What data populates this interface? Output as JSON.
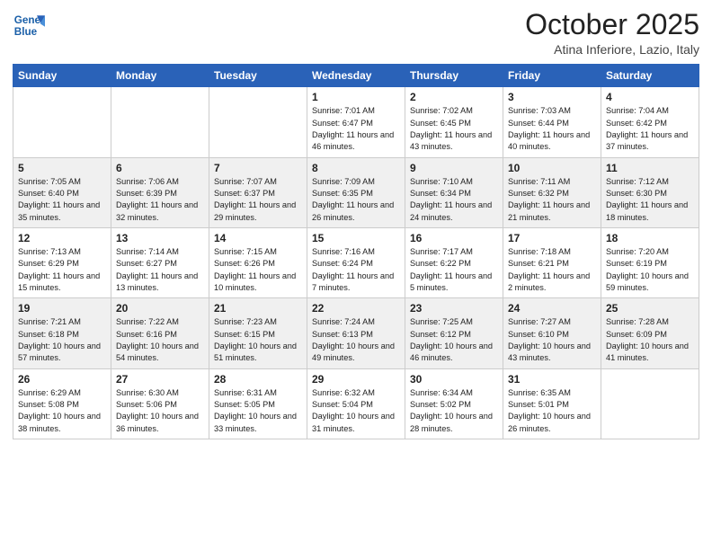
{
  "header": {
    "logo_line1": "General",
    "logo_line2": "Blue",
    "month_title": "October 2025",
    "location": "Atina Inferiore, Lazio, Italy"
  },
  "days_of_week": [
    "Sunday",
    "Monday",
    "Tuesday",
    "Wednesday",
    "Thursday",
    "Friday",
    "Saturday"
  ],
  "weeks": [
    [
      {
        "day": "",
        "info": ""
      },
      {
        "day": "",
        "info": ""
      },
      {
        "day": "",
        "info": ""
      },
      {
        "day": "1",
        "info": "Sunrise: 7:01 AM\nSunset: 6:47 PM\nDaylight: 11 hours and 46 minutes."
      },
      {
        "day": "2",
        "info": "Sunrise: 7:02 AM\nSunset: 6:45 PM\nDaylight: 11 hours and 43 minutes."
      },
      {
        "day": "3",
        "info": "Sunrise: 7:03 AM\nSunset: 6:44 PM\nDaylight: 11 hours and 40 minutes."
      },
      {
        "day": "4",
        "info": "Sunrise: 7:04 AM\nSunset: 6:42 PM\nDaylight: 11 hours and 37 minutes."
      }
    ],
    [
      {
        "day": "5",
        "info": "Sunrise: 7:05 AM\nSunset: 6:40 PM\nDaylight: 11 hours and 35 minutes."
      },
      {
        "day": "6",
        "info": "Sunrise: 7:06 AM\nSunset: 6:39 PM\nDaylight: 11 hours and 32 minutes."
      },
      {
        "day": "7",
        "info": "Sunrise: 7:07 AM\nSunset: 6:37 PM\nDaylight: 11 hours and 29 minutes."
      },
      {
        "day": "8",
        "info": "Sunrise: 7:09 AM\nSunset: 6:35 PM\nDaylight: 11 hours and 26 minutes."
      },
      {
        "day": "9",
        "info": "Sunrise: 7:10 AM\nSunset: 6:34 PM\nDaylight: 11 hours and 24 minutes."
      },
      {
        "day": "10",
        "info": "Sunrise: 7:11 AM\nSunset: 6:32 PM\nDaylight: 11 hours and 21 minutes."
      },
      {
        "day": "11",
        "info": "Sunrise: 7:12 AM\nSunset: 6:30 PM\nDaylight: 11 hours and 18 minutes."
      }
    ],
    [
      {
        "day": "12",
        "info": "Sunrise: 7:13 AM\nSunset: 6:29 PM\nDaylight: 11 hours and 15 minutes."
      },
      {
        "day": "13",
        "info": "Sunrise: 7:14 AM\nSunset: 6:27 PM\nDaylight: 11 hours and 13 minutes."
      },
      {
        "day": "14",
        "info": "Sunrise: 7:15 AM\nSunset: 6:26 PM\nDaylight: 11 hours and 10 minutes."
      },
      {
        "day": "15",
        "info": "Sunrise: 7:16 AM\nSunset: 6:24 PM\nDaylight: 11 hours and 7 minutes."
      },
      {
        "day": "16",
        "info": "Sunrise: 7:17 AM\nSunset: 6:22 PM\nDaylight: 11 hours and 5 minutes."
      },
      {
        "day": "17",
        "info": "Sunrise: 7:18 AM\nSunset: 6:21 PM\nDaylight: 11 hours and 2 minutes."
      },
      {
        "day": "18",
        "info": "Sunrise: 7:20 AM\nSunset: 6:19 PM\nDaylight: 10 hours and 59 minutes."
      }
    ],
    [
      {
        "day": "19",
        "info": "Sunrise: 7:21 AM\nSunset: 6:18 PM\nDaylight: 10 hours and 57 minutes."
      },
      {
        "day": "20",
        "info": "Sunrise: 7:22 AM\nSunset: 6:16 PM\nDaylight: 10 hours and 54 minutes."
      },
      {
        "day": "21",
        "info": "Sunrise: 7:23 AM\nSunset: 6:15 PM\nDaylight: 10 hours and 51 minutes."
      },
      {
        "day": "22",
        "info": "Sunrise: 7:24 AM\nSunset: 6:13 PM\nDaylight: 10 hours and 49 minutes."
      },
      {
        "day": "23",
        "info": "Sunrise: 7:25 AM\nSunset: 6:12 PM\nDaylight: 10 hours and 46 minutes."
      },
      {
        "day": "24",
        "info": "Sunrise: 7:27 AM\nSunset: 6:10 PM\nDaylight: 10 hours and 43 minutes."
      },
      {
        "day": "25",
        "info": "Sunrise: 7:28 AM\nSunset: 6:09 PM\nDaylight: 10 hours and 41 minutes."
      }
    ],
    [
      {
        "day": "26",
        "info": "Sunrise: 6:29 AM\nSunset: 5:08 PM\nDaylight: 10 hours and 38 minutes."
      },
      {
        "day": "27",
        "info": "Sunrise: 6:30 AM\nSunset: 5:06 PM\nDaylight: 10 hours and 36 minutes."
      },
      {
        "day": "28",
        "info": "Sunrise: 6:31 AM\nSunset: 5:05 PM\nDaylight: 10 hours and 33 minutes."
      },
      {
        "day": "29",
        "info": "Sunrise: 6:32 AM\nSunset: 5:04 PM\nDaylight: 10 hours and 31 minutes."
      },
      {
        "day": "30",
        "info": "Sunrise: 6:34 AM\nSunset: 5:02 PM\nDaylight: 10 hours and 28 minutes."
      },
      {
        "day": "31",
        "info": "Sunrise: 6:35 AM\nSunset: 5:01 PM\nDaylight: 10 hours and 26 minutes."
      },
      {
        "day": "",
        "info": ""
      }
    ]
  ]
}
